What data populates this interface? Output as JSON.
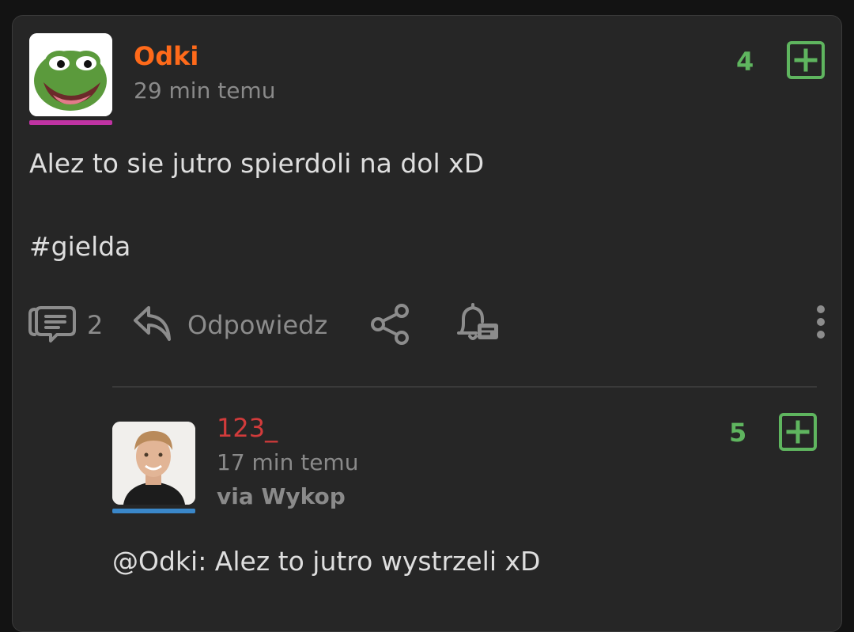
{
  "colors": {
    "vote_green": "#5fb55f",
    "op_name": "#ff6a1a",
    "reply_name": "#d23b3b",
    "op_bar": "#c033a3",
    "reply_bar": "#3a87c9",
    "text": "#dedede",
    "muted": "#8a8a8a"
  },
  "post": {
    "author": "Odki",
    "time": "29 min temu",
    "votes": "4",
    "body_line1": "Alez to sie jutro spierdoli na dol xD",
    "body_line2": "#gielda",
    "comments_count": "2",
    "reply_label": "Odpowiedz",
    "avatar_icon": "pepe-frog-avatar"
  },
  "comment": {
    "author": "123_",
    "time": "17 min temu",
    "via": "via Wykop",
    "votes": "5",
    "mention": "@Odki",
    "body": ": Alez to jutro wystrzeli xD",
    "avatar_icon": "man-portrait-avatar"
  },
  "icons": {
    "upvote": "plus-square-icon",
    "comments": "comments-icon",
    "reply": "reply-arrow-icon",
    "share": "share-icon",
    "notify": "bell-icon",
    "more": "more-vertical-icon"
  }
}
